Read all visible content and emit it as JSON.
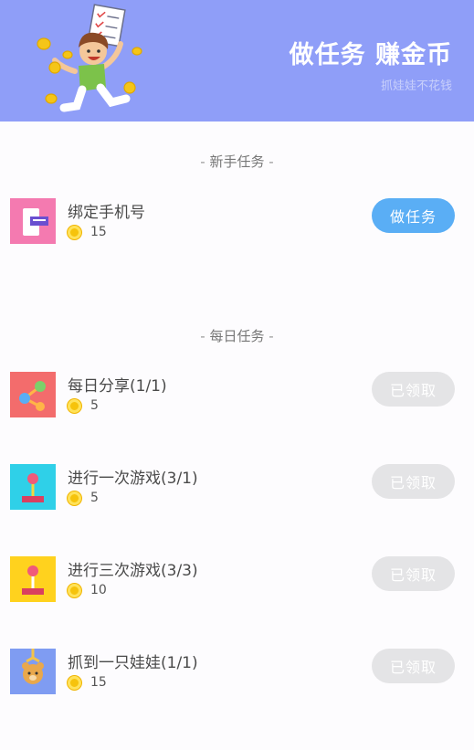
{
  "banner": {
    "title": "做任务 赚金币",
    "subtitle": "抓娃娃不花钱"
  },
  "sections": {
    "newbie": {
      "label": "新手任务"
    },
    "daily": {
      "label": "每日任务"
    }
  },
  "tasks": [
    {
      "title": "绑定手机号",
      "reward": "15",
      "button": "做任务",
      "status": "todo",
      "icon": "phone-bind-icon"
    },
    {
      "title": "每日分享(1/1)",
      "reward": "5",
      "button": "已领取",
      "status": "claimed",
      "icon": "share-icon"
    },
    {
      "title": "进行一次游戏(3/1)",
      "reward": "5",
      "button": "已领取",
      "status": "claimed",
      "icon": "joystick-icon"
    },
    {
      "title": "进行三次游戏(3/3)",
      "reward": "10",
      "button": "已领取",
      "status": "claimed",
      "icon": "joystick-icon"
    },
    {
      "title": "抓到一只娃娃(1/1)",
      "reward": "15",
      "button": "已领取",
      "status": "claimed",
      "icon": "doll-claw-icon"
    }
  ],
  "colors": {
    "banner": "#8f9ef8",
    "primary_button": "#5aaef5",
    "disabled_button": "#e4e4e6",
    "coin": "#f6c30c"
  }
}
